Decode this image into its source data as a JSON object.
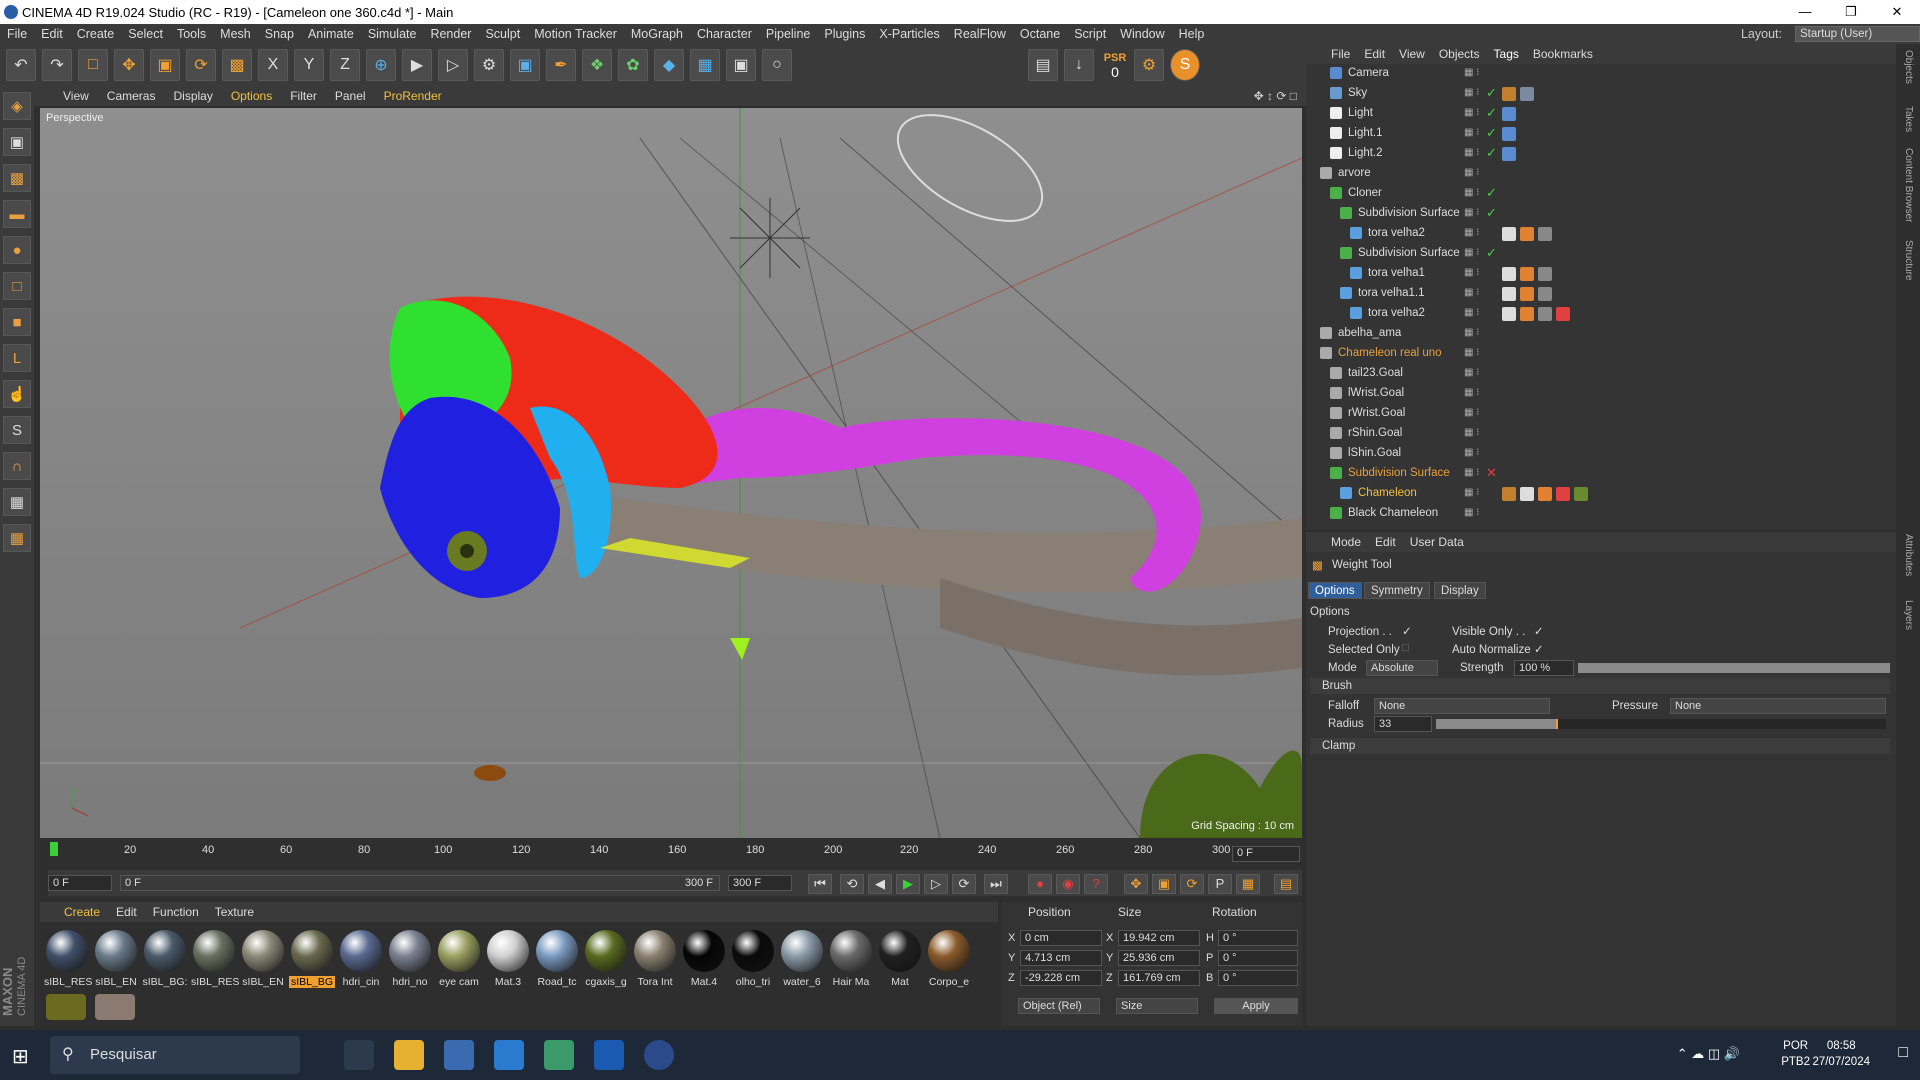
{
  "window": {
    "title": "CINEMA 4D R19.024 Studio (RC - R19) - [Cameleon one 360.c4d *] - Main"
  },
  "menubar": {
    "items": [
      "File",
      "Edit",
      "Create",
      "Select",
      "Tools",
      "Mesh",
      "Snap",
      "Animate",
      "Simulate",
      "Render",
      "Sculpt",
      "Motion Tracker",
      "MoGraph",
      "Character",
      "Pipeline",
      "Plugins",
      "X-Particles",
      "RealFlow",
      "Octane",
      "Script",
      "Window",
      "Help"
    ],
    "layout_label": "Layout:",
    "layout_value": "Startup (User)"
  },
  "toolbar": {
    "psr_label": "PSR",
    "psr_value": "0"
  },
  "viewport": {
    "menu": [
      "View",
      "Cameras",
      "Display",
      "Options",
      "Filter",
      "Panel",
      "ProRender"
    ],
    "camera_label": "Perspective",
    "grid_spacing": "Grid Spacing : 10 cm"
  },
  "timeline": {
    "ticks": [
      "0",
      "20",
      "40",
      "60",
      "80",
      "100",
      "120",
      "140",
      "160",
      "180",
      "200",
      "220",
      "240",
      "260",
      "280",
      "300"
    ],
    "current": "0 F"
  },
  "transport": {
    "start": "0 F",
    "range_start": "0 F",
    "range_end": "300 F",
    "end": "300 F"
  },
  "material_menu": [
    "Create",
    "Edit",
    "Function",
    "Texture"
  ],
  "materials": [
    {
      "name": "sIBL_RES",
      "color": "#40506a"
    },
    {
      "name": "sIBL_EN",
      "color": "#6a7a8a"
    },
    {
      "name": "sIBL_BG:",
      "color": "#4a5a6a"
    },
    {
      "name": "sIBL_RES",
      "color": "#6a7060"
    },
    {
      "name": "sIBL_EN",
      "color": "#8a8a78"
    },
    {
      "name": "sIBL_BG",
      "color": "#6a6a50"
    },
    {
      "name": "hdri_cin",
      "color": "#5a6a90"
    },
    {
      "name": "hdri_no",
      "color": "#7a8090"
    },
    {
      "name": "eye cam",
      "color": "#9aa060"
    },
    {
      "name": "Mat.3",
      "color": "#d0d0d0"
    },
    {
      "name": "Road_tc",
      "color": "#7a9ac0"
    },
    {
      "name": "cgaxis_g",
      "color": "#5a6a20"
    },
    {
      "name": "Tora Int",
      "color": "#8a8070"
    },
    {
      "name": "Mat.4",
      "color": "#050505"
    },
    {
      "name": "olho_tri",
      "color": "#0a0a0a"
    },
    {
      "name": "water_6",
      "color": "#8a9aa8"
    },
    {
      "name": "Hair Ma",
      "color": "#6a6a6a"
    },
    {
      "name": "Mat",
      "color": "#202020"
    },
    {
      "name": "Corpo_e",
      "color": "#8a5a2a"
    }
  ],
  "coords": {
    "headers": [
      "Position",
      "Size",
      "Rotation"
    ],
    "rows": [
      {
        "axis": "X",
        "pos": "0 cm",
        "saxis": "X",
        "size": "19.942 cm",
        "raxis": "H",
        "rot": "0 °"
      },
      {
        "axis": "Y",
        "pos": "4.713 cm",
        "saxis": "Y",
        "size": "25.936 cm",
        "raxis": "P",
        "rot": "0 °"
      },
      {
        "axis": "Z",
        "pos": "-29.228 cm",
        "saxis": "Z",
        "size": "161.769 cm",
        "raxis": "B",
        "rot": "0 °"
      }
    ],
    "mode": "Object (Rel)",
    "size_mode": "Size",
    "apply": "Apply"
  },
  "object_manager": {
    "menu": [
      "File",
      "Edit",
      "View",
      "Objects",
      "Tags",
      "Bookmarks"
    ],
    "objects": [
      {
        "name": "Camera",
        "indent": 1,
        "color": "#ddd",
        "icon": "#5a8ad0"
      },
      {
        "name": "Sky",
        "indent": 1,
        "color": "#ddd",
        "icon": "#6a9ad0"
      },
      {
        "name": "Light",
        "indent": 1,
        "color": "#ddd",
        "icon": "#eeeeee"
      },
      {
        "name": "Light.1",
        "indent": 1,
        "color": "#ddd",
        "icon": "#eeeeee"
      },
      {
        "name": "Light.2",
        "indent": 1,
        "color": "#ddd",
        "icon": "#eeeeee"
      },
      {
        "name": "arvore",
        "indent": 0,
        "color": "#ddd",
        "icon": "#aaaaaa"
      },
      {
        "name": "Cloner",
        "indent": 1,
        "color": "#ddd",
        "icon": "#4ab04a"
      },
      {
        "name": "Subdivision Surface",
        "indent": 2,
        "color": "#ddd",
        "icon": "#4ab04a"
      },
      {
        "name": "tora velha2",
        "indent": 3,
        "color": "#ddd",
        "icon": "#5aa0e0"
      },
      {
        "name": "Subdivision Surface",
        "indent": 2,
        "color": "#ddd",
        "icon": "#4ab04a"
      },
      {
        "name": "tora velha1",
        "indent": 3,
        "color": "#ddd",
        "icon": "#5aa0e0"
      },
      {
        "name": "tora velha1.1",
        "indent": 2,
        "color": "#ddd",
        "icon": "#5aa0e0"
      },
      {
        "name": "tora velha2",
        "indent": 3,
        "color": "#ddd",
        "icon": "#5aa0e0"
      },
      {
        "name": "abelha_ama",
        "indent": 0,
        "color": "#ddd",
        "icon": "#aaaaaa"
      },
      {
        "name": "Chameleon real uno",
        "indent": 0,
        "color": "#e8a040",
        "icon": "#aaaaaa"
      },
      {
        "name": "tail23.Goal",
        "indent": 1,
        "color": "#ddd",
        "icon": "#aaaaaa"
      },
      {
        "name": "lWrist.Goal",
        "indent": 1,
        "color": "#ddd",
        "icon": "#aaaaaa"
      },
      {
        "name": "rWrist.Goal",
        "indent": 1,
        "color": "#ddd",
        "icon": "#aaaaaa"
      },
      {
        "name": "rShin.Goal",
        "indent": 1,
        "color": "#ddd",
        "icon": "#aaaaaa"
      },
      {
        "name": "lShin.Goal",
        "indent": 1,
        "color": "#ddd",
        "icon": "#aaaaaa"
      },
      {
        "name": "Subdivision Surface",
        "indent": 1,
        "color": "#e8a040",
        "icon": "#4ab04a"
      },
      {
        "name": "Chameleon",
        "indent": 2,
        "color": "#f0c040",
        "icon": "#5aa0e0"
      },
      {
        "name": "Black Chameleon",
        "indent": 1,
        "color": "#ddd",
        "icon": "#4ab04a"
      }
    ]
  },
  "attributes": {
    "menu": [
      "Mode",
      "Edit",
      "User Data"
    ],
    "tool": "Weight Tool",
    "tabs": [
      "Options",
      "Symmetry",
      "Display"
    ],
    "section": "Options",
    "projection": "Projection . .",
    "visible_only": "Visible Only . .",
    "selected_only": "Selected Only",
    "auto_normalize": "Auto Normalize",
    "mode_label": "Mode",
    "mode_value": "Absolute",
    "strength_label": "Strength",
    "strength_value": "100 %",
    "brush": "Brush",
    "falloff_label": "Falloff",
    "falloff_value": "None",
    "pressure_label": "Pressure",
    "pressure_value": "None",
    "radius_label": "Radius",
    "radius_value": "33",
    "clamp": "Clamp"
  },
  "right_tabs": [
    "Objects",
    "Takes",
    "Content Browser",
    "Structure",
    "Attributes",
    "Layers"
  ],
  "taskbar": {
    "search": "Pesquisar",
    "lang1": "POR",
    "lang2": "PTB2",
    "time": "08:58",
    "date": "27/07/2024"
  },
  "brand": {
    "maxon": "MAXON",
    "c4d": "CINEMA 4D"
  }
}
